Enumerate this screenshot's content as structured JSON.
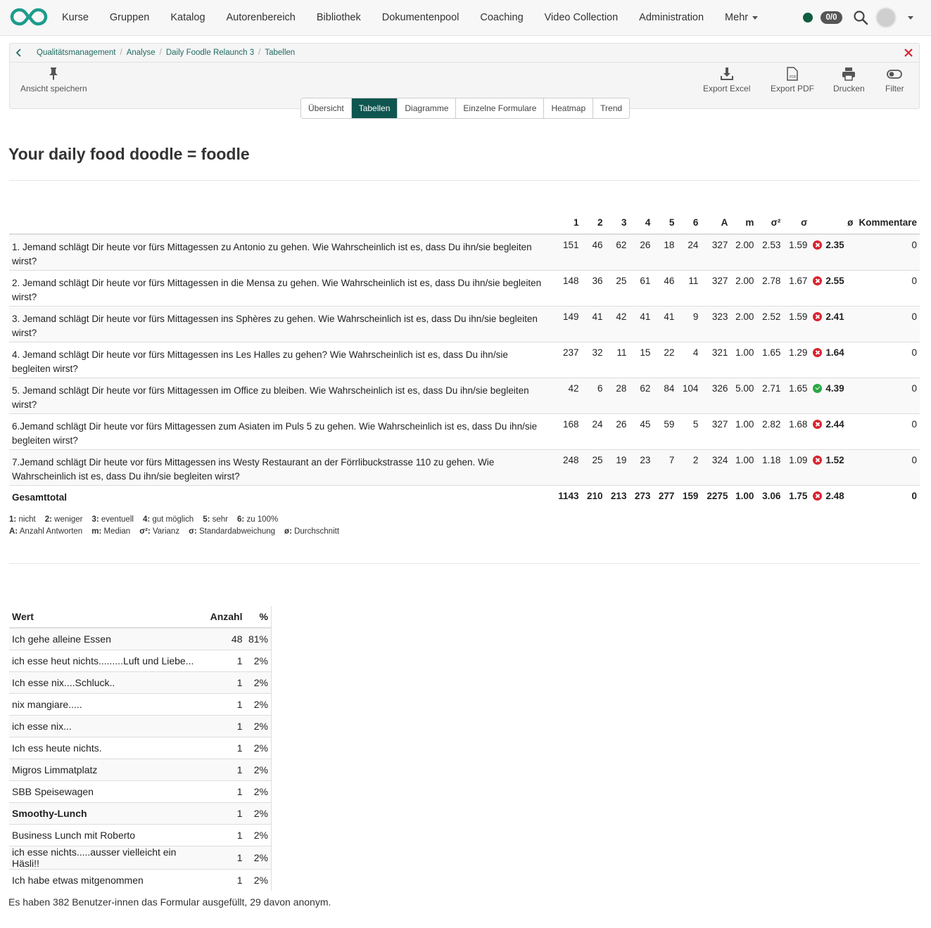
{
  "nav": {
    "items": [
      "Kurse",
      "Gruppen",
      "Katalog",
      "Autorenbereich",
      "Bibliothek",
      "Dokumentenpool",
      "Coaching",
      "Video Collection",
      "Administration",
      "Mehr"
    ],
    "counter": "0/0",
    "status_color": "#0f5d3f"
  },
  "breadcrumb": [
    "Qualitätsmanagement",
    "Analyse",
    "Daily Foodle Relaunch 3",
    "Tabellen"
  ],
  "toolbar": {
    "save_view": "Ansicht speichern",
    "export_excel": "Export Excel",
    "export_pdf": "Export PDF",
    "print": "Drucken",
    "filter": "Filter"
  },
  "tabs": [
    "Übersicht",
    "Tabellen",
    "Diagramme",
    "Einzelne Formulare",
    "Heatmap",
    "Trend"
  ],
  "active_tab": "Tabellen",
  "title": "Your daily food doodle = foodle",
  "stats_table": {
    "headers": [
      "1",
      "2",
      "3",
      "4",
      "5",
      "6",
      "A",
      "m",
      "σ²",
      "σ",
      "ø",
      "Kommentare"
    ],
    "rows": [
      {
        "question": "1. Jemand schlägt Dir heute vor fürs Mittagessen zu Antonio zu gehen. Wie Wahrscheinlich ist es, dass Du ihn/sie begleiten wirst?",
        "v1": "151",
        "v2": "46",
        "v3": "62",
        "v4": "26",
        "v5": "18",
        "v6": "24",
        "a": "327",
        "m": "2.00",
        "var": "2.53",
        "sd": "1.59",
        "avg": "2.35",
        "status": "bad",
        "comments": "0"
      },
      {
        "question": "2. Jemand schlägt Dir heute vor fürs Mittagessen in die Mensa zu gehen. Wie Wahrscheinlich ist es, dass Du ihn/sie begleiten wirst?",
        "v1": "148",
        "v2": "36",
        "v3": "25",
        "v4": "61",
        "v5": "46",
        "v6": "11",
        "a": "327",
        "m": "2.00",
        "var": "2.78",
        "sd": "1.67",
        "avg": "2.55",
        "status": "bad",
        "comments": "0"
      },
      {
        "question": "3. Jemand schlägt Dir heute vor fürs Mittagessen ins Sphères zu gehen. Wie Wahrscheinlich ist es, dass Du ihn/sie begleiten wirst?",
        "v1": "149",
        "v2": "41",
        "v3": "42",
        "v4": "41",
        "v5": "41",
        "v6": "9",
        "a": "323",
        "m": "2.00",
        "var": "2.52",
        "sd": "1.59",
        "avg": "2.41",
        "status": "bad",
        "comments": "0"
      },
      {
        "question": "4. Jemand schlägt Dir heute vor fürs Mittagessen ins Les Halles zu gehen? Wie Wahrscheinlich ist es, dass Du ihn/sie begleiten wirst?",
        "v1": "237",
        "v2": "32",
        "v3": "11",
        "v4": "15",
        "v5": "22",
        "v6": "4",
        "a": "321",
        "m": "1.00",
        "var": "1.65",
        "sd": "1.29",
        "avg": "1.64",
        "status": "bad",
        "comments": "0"
      },
      {
        "question": "5. Jemand schlägt Dir heute vor fürs Mittagessen im Office zu bleiben. Wie Wahrscheinlich ist es, dass Du ihn/sie begleiten wirst?",
        "v1": "42",
        "v2": "6",
        "v3": "28",
        "v4": "62",
        "v5": "84",
        "v6": "104",
        "a": "326",
        "m": "5.00",
        "var": "2.71",
        "sd": "1.65",
        "avg": "4.39",
        "status": "good",
        "comments": "0"
      },
      {
        "question": "6.Jemand schlägt Dir heute vor fürs Mittagessen zum Asiaten im Puls 5 zu gehen. Wie Wahrscheinlich ist es, dass Du ihn/sie begleiten wirst?",
        "v1": "168",
        "v2": "24",
        "v3": "26",
        "v4": "45",
        "v5": "59",
        "v6": "5",
        "a": "327",
        "m": "1.00",
        "var": "2.82",
        "sd": "1.68",
        "avg": "2.44",
        "status": "bad",
        "comments": "0"
      },
      {
        "question": "7.Jemand schlägt Dir heute vor fürs Mittagessen ins Westy Restaurant an der Förrlibuckstrasse 110 zu gehen. Wie Wahrscheinlich ist es, dass Du ihn/sie begleiten wirst?",
        "v1": "248",
        "v2": "25",
        "v3": "19",
        "v4": "23",
        "v5": "7",
        "v6": "2",
        "a": "324",
        "m": "1.00",
        "var": "1.18",
        "sd": "1.09",
        "avg": "1.52",
        "status": "bad",
        "comments": "0"
      }
    ],
    "total": {
      "label": "Gesamttotal",
      "v1": "1143",
      "v2": "210",
      "v3": "213",
      "v4": "273",
      "v5": "277",
      "v6": "159",
      "a": "2275",
      "m": "1.00",
      "var": "3.06",
      "sd": "1.75",
      "avg": "2.48",
      "status": "bad",
      "comments": "0"
    }
  },
  "legend": {
    "scale": [
      {
        "key": "1:",
        "text": "nicht"
      },
      {
        "key": "2:",
        "text": "weniger"
      },
      {
        "key": "3:",
        "text": "eventuell"
      },
      {
        "key": "4:",
        "text": "gut möglich"
      },
      {
        "key": "5:",
        "text": "sehr"
      },
      {
        "key": "6:",
        "text": "zu 100%"
      }
    ],
    "stats": [
      {
        "key": "A:",
        "text": "Anzahl Antworten"
      },
      {
        "key": "m:",
        "text": "Median"
      },
      {
        "key": "σ²:",
        "text": "Varianz"
      },
      {
        "key": "σ:",
        "text": "Standardabweichung"
      },
      {
        "key": "ø:",
        "text": "Durchschnitt"
      }
    ]
  },
  "value_table": {
    "headers": [
      "Wert",
      "Anzahl",
      "%"
    ],
    "rows": [
      {
        "value": "Ich gehe alleine Essen",
        "count": "48",
        "pct": "81%",
        "bold": false
      },
      {
        "value": "ich esse heut nichts.........Luft und Liebe...",
        "count": "1",
        "pct": "2%",
        "bold": false
      },
      {
        "value": "Ich esse nix....Schluck..",
        "count": "1",
        "pct": "2%",
        "bold": false
      },
      {
        "value": "nix mangiare.....",
        "count": "1",
        "pct": "2%",
        "bold": false
      },
      {
        "value": "ich esse nix...",
        "count": "1",
        "pct": "2%",
        "bold": false
      },
      {
        "value": "Ich ess heute nichts.",
        "count": "1",
        "pct": "2%",
        "bold": false
      },
      {
        "value": "Migros Limmatplatz",
        "count": "1",
        "pct": "2%",
        "bold": false
      },
      {
        "value": "SBB Speisewagen",
        "count": "1",
        "pct": "2%",
        "bold": false
      },
      {
        "value": "Smoothy-Lunch",
        "count": "1",
        "pct": "2%",
        "bold": true
      },
      {
        "value": "Business Lunch mit Roberto",
        "count": "1",
        "pct": "2%",
        "bold": false
      },
      {
        "value": "ich esse nichts.....ausser vielleicht ein Häsli!!",
        "count": "1",
        "pct": "2%",
        "bold": false
      },
      {
        "value": "Ich habe etwas mitgenommen",
        "count": "1",
        "pct": "2%",
        "bold": false
      }
    ]
  },
  "footer_note": "Es haben 382 Benutzer-innen das Formular ausgefüllt, 29 davon anonym."
}
